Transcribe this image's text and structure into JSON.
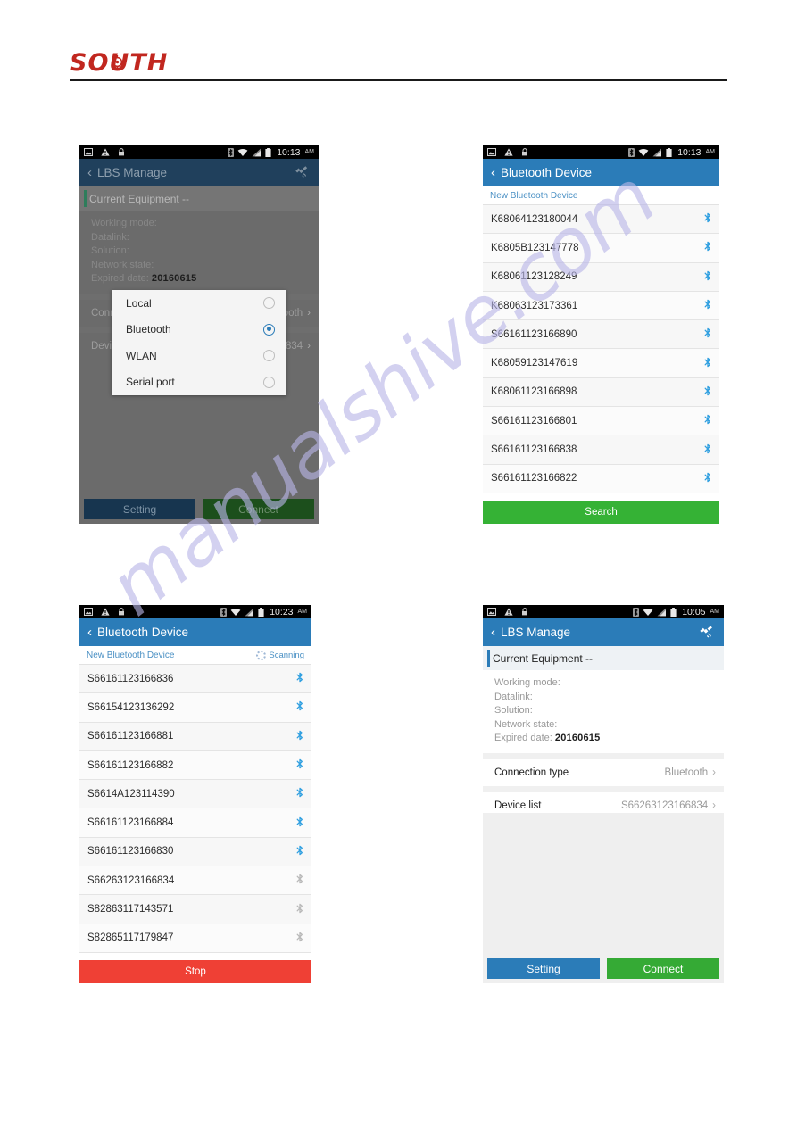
{
  "brand": {
    "name": "SOUTH"
  },
  "watermark": {
    "text": "manualshive.com"
  },
  "panel1": {
    "name": "lbs-manage-connection-type-dialog",
    "statusbar": {
      "icons": [
        "image-icon",
        "warning-triangle-icon",
        "lock-icon",
        "bluetooth-icon",
        "wifi-icon",
        "signal-icon",
        "battery-icon"
      ],
      "time": "10:13",
      "ampm": "AM"
    },
    "appbar": {
      "back": "‹",
      "title": "LBS Manage",
      "action_icon": "satellite-icon"
    },
    "equipment": {
      "label": "Current Equipment --"
    },
    "info": {
      "working_mode_label": "Working mode:",
      "datalink_label": "Datalink:",
      "solution_label": "Solution:",
      "network_state_label": "Network state:",
      "expired_date_label": "Expired date:",
      "expired_date_value": "20160615"
    },
    "rows": [
      {
        "key": "Connection type",
        "value": "Bluetooth",
        "arrow": "›"
      },
      {
        "key": "Device list",
        "value": "S66263123166834",
        "arrow": "›"
      }
    ],
    "dialog": {
      "options": [
        {
          "label": "Local",
          "selected": false
        },
        {
          "label": "Bluetooth",
          "selected": true
        },
        {
          "label": "WLAN",
          "selected": false
        },
        {
          "label": "Serial port",
          "selected": false
        }
      ]
    },
    "actions": {
      "setting": "Setting",
      "connect": "Connect"
    }
  },
  "panel2": {
    "name": "bluetooth-device-list",
    "statusbar": {
      "icons": [
        "image-icon",
        "warning-triangle-icon",
        "lock-icon",
        "bluetooth-icon",
        "wifi-icon",
        "signal-icon",
        "battery-icon"
      ],
      "time": "10:13",
      "ampm": "AM"
    },
    "appbar": {
      "back": "‹",
      "title": "Bluetooth Device"
    },
    "subhead": {
      "label": "New Bluetooth Device"
    },
    "devices": [
      "K68064123180044",
      "K6805B123147778",
      "K68061123128249",
      "K68063123173361",
      "S66161123166890",
      "K68059123147619",
      "K68061123166898",
      "S66161123166801",
      "S66161123166838",
      "S66161123166822"
    ],
    "button": {
      "label": "Search",
      "color": "#35b235"
    }
  },
  "panel3": {
    "name": "bluetooth-device-scanning",
    "statusbar": {
      "icons": [
        "image-icon",
        "warning-triangle-icon",
        "lock-icon",
        "bluetooth-icon",
        "wifi-icon",
        "signal-icon",
        "battery-icon"
      ],
      "time": "10:23",
      "ampm": "AM"
    },
    "appbar": {
      "back": "‹",
      "title": "Bluetooth Device"
    },
    "subhead": {
      "label": "New Bluetooth Device",
      "status": "Scanning"
    },
    "devices": [
      "S66161123166836",
      "S66154123136292",
      "S66161123166881",
      "S66161123166882",
      "S6614A123114390",
      "S66161123166884",
      "S66161123166830",
      "S66263123166834",
      "S82863117143571",
      "S82865117179847"
    ],
    "button": {
      "label": "Stop",
      "color": "#ef4035"
    }
  },
  "panel4": {
    "name": "lbs-manage-connected",
    "statusbar": {
      "icons": [
        "image-icon",
        "warning-triangle-icon",
        "lock-icon",
        "bluetooth-icon",
        "wifi-icon",
        "signal-icon",
        "battery-icon"
      ],
      "time": "10:05",
      "ampm": "AM"
    },
    "appbar": {
      "back": "‹",
      "title": "LBS Manage",
      "action_icon": "satellite-icon"
    },
    "equipment": {
      "label": "Current Equipment --"
    },
    "info": {
      "working_mode_label": "Working mode:",
      "datalink_label": "Datalink:",
      "solution_label": "Solution:",
      "network_state_label": "Network state:",
      "expired_date_label": "Expired date:",
      "expired_date_value": "20160615"
    },
    "rows": [
      {
        "key": "Connection type",
        "value": "Bluetooth",
        "arrow": "›"
      },
      {
        "key": "Device list",
        "value": "S66263123166834",
        "arrow": "›"
      }
    ],
    "actions": {
      "setting": "Setting",
      "connect": "Connect"
    }
  }
}
